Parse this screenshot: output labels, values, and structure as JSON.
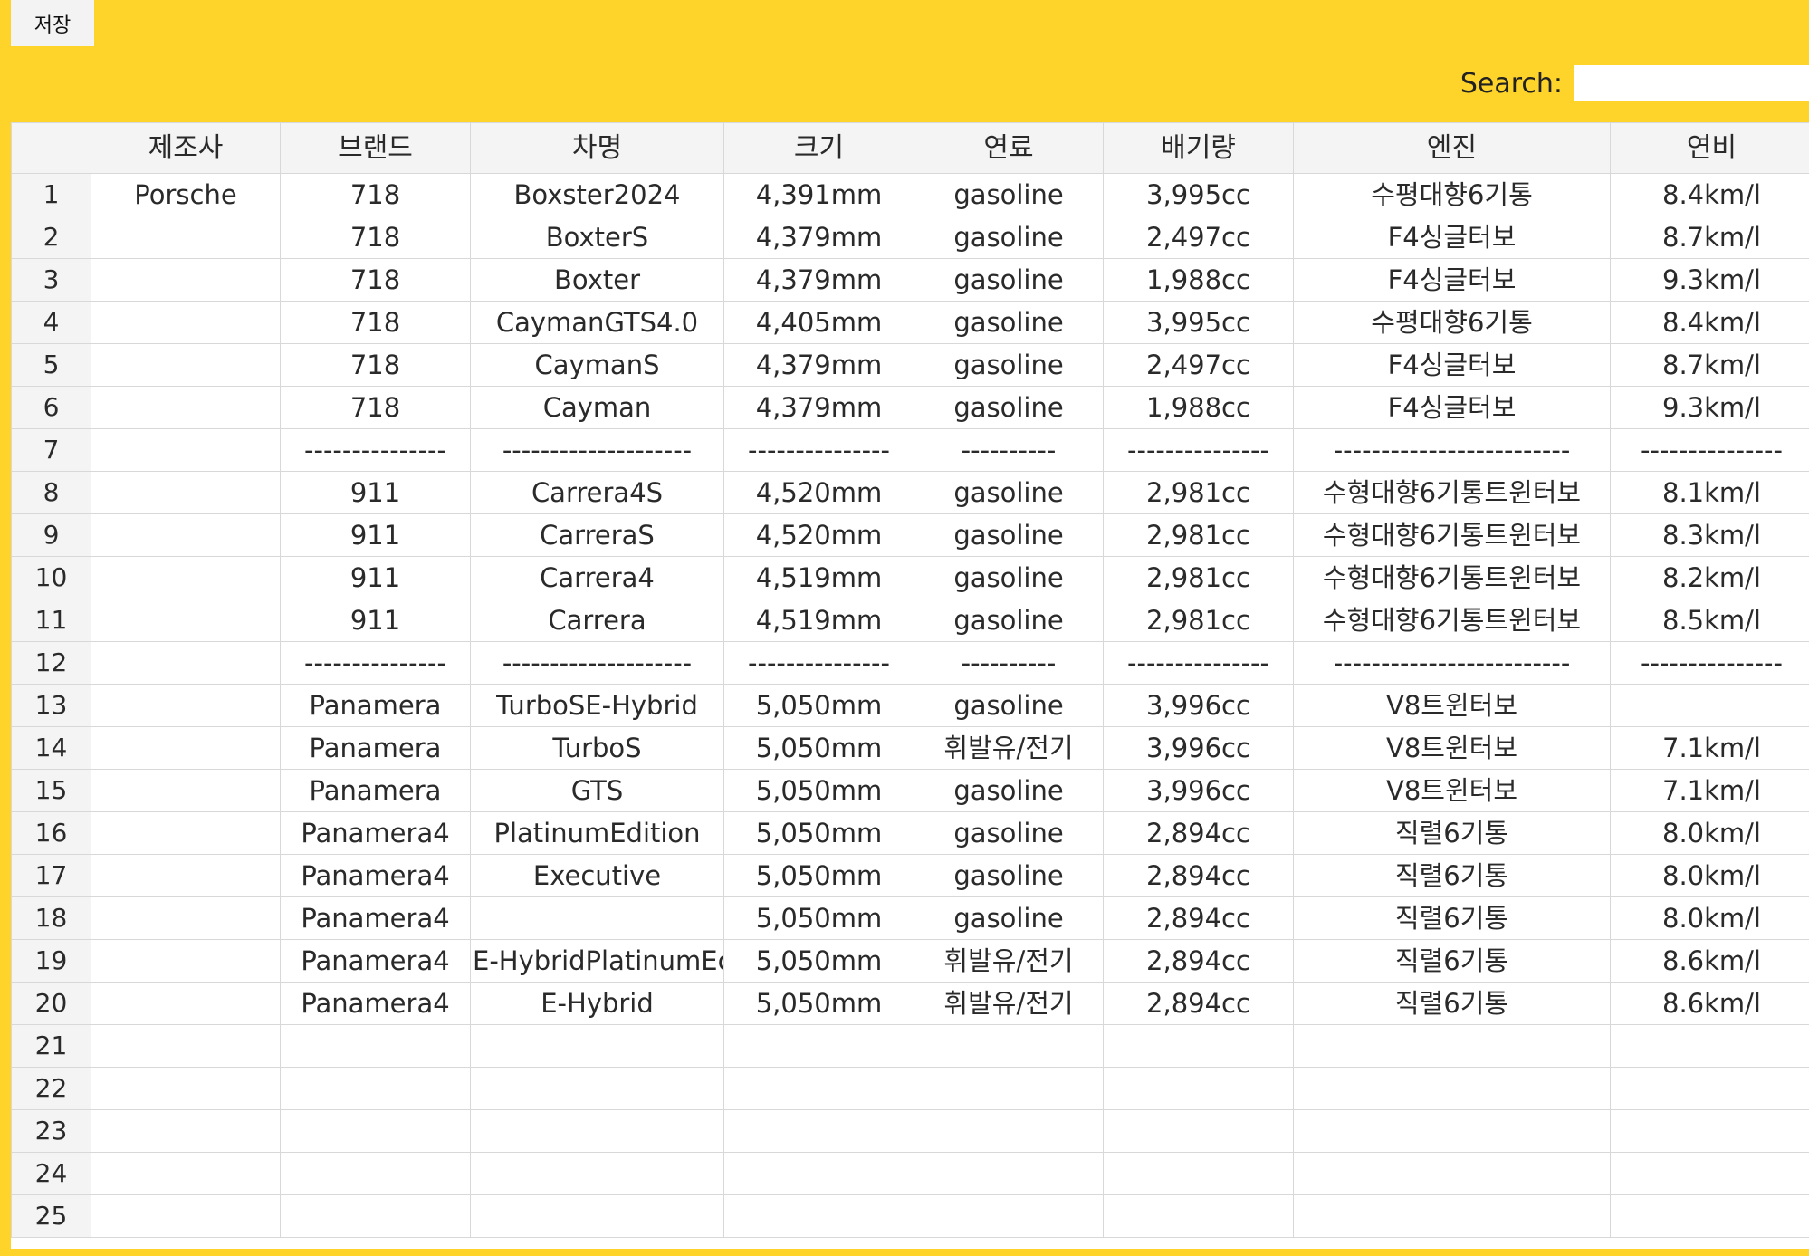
{
  "toolbar": {
    "save_label": "저장"
  },
  "search": {
    "label": "Search:",
    "value": "",
    "placeholder": ""
  },
  "table": {
    "headers": [
      "",
      "제조사",
      "브랜드",
      "차명",
      "크기",
      "연료",
      "배기량",
      "엔진",
      "연비"
    ],
    "rows": [
      [
        "1",
        "Porsche",
        "718",
        "Boxster2024",
        "4,391mm",
        "gasoline",
        "3,995cc",
        "수평대향6기통",
        "8.4km/l"
      ],
      [
        "2",
        "",
        "718",
        "BoxterS",
        "4,379mm",
        "gasoline",
        "2,497cc",
        "F4싱글터보",
        "8.7km/l"
      ],
      [
        "3",
        "",
        "718",
        "Boxter",
        "4,379mm",
        "gasoline",
        "1,988cc",
        "F4싱글터보",
        "9.3km/l"
      ],
      [
        "4",
        "",
        "718",
        "CaymanGTS4.0",
        "4,405mm",
        "gasoline",
        "3,995cc",
        "수평대향6기통",
        "8.4km/l"
      ],
      [
        "5",
        "",
        "718",
        "CaymanS",
        "4,379mm",
        "gasoline",
        "2,497cc",
        "F4싱글터보",
        "8.7km/l"
      ],
      [
        "6",
        "",
        "718",
        "Cayman",
        "4,379mm",
        "gasoline",
        "1,988cc",
        "F4싱글터보",
        "9.3km/l"
      ],
      [
        "7",
        "",
        "---------------",
        "--------------------",
        "---------------",
        "----------",
        "---------------",
        "-------------------------",
        "---------------"
      ],
      [
        "8",
        "",
        "911",
        "Carrera4S",
        "4,520mm",
        "gasoline",
        "2,981cc",
        "수형대향6기통트윈터보",
        "8.1km/l"
      ],
      [
        "9",
        "",
        "911",
        "CarreraS",
        "4,520mm",
        "gasoline",
        "2,981cc",
        "수형대향6기통트윈터보",
        "8.3km/l"
      ],
      [
        "10",
        "",
        "911",
        "Carrera4",
        "4,519mm",
        "gasoline",
        "2,981cc",
        "수형대향6기통트윈터보",
        "8.2km/l"
      ],
      [
        "11",
        "",
        "911",
        "Carrera",
        "4,519mm",
        "gasoline",
        "2,981cc",
        "수형대향6기통트윈터보",
        "8.5km/l"
      ],
      [
        "12",
        "",
        "---------------",
        "--------------------",
        "---------------",
        "----------",
        "---------------",
        "-------------------------",
        "---------------"
      ],
      [
        "13",
        "",
        "Panamera",
        "TurboSE-Hybrid",
        "5,050mm",
        "gasoline",
        "3,996cc",
        "V8트윈터보",
        ""
      ],
      [
        "14",
        "",
        "Panamera",
        "TurboS",
        "5,050mm",
        "휘발유/전기",
        "3,996cc",
        "V8트윈터보",
        "7.1km/l"
      ],
      [
        "15",
        "",
        "Panamera",
        "GTS",
        "5,050mm",
        "gasoline",
        "3,996cc",
        "V8트윈터보",
        "7.1km/l"
      ],
      [
        "16",
        "",
        "Panamera4",
        "PlatinumEdition",
        "5,050mm",
        "gasoline",
        "2,894cc",
        "직렬6기통",
        "8.0km/l"
      ],
      [
        "17",
        "",
        "Panamera4",
        "Executive",
        "5,050mm",
        "gasoline",
        "2,894cc",
        "직렬6기통",
        "8.0km/l"
      ],
      [
        "18",
        "",
        "Panamera4",
        "",
        "5,050mm",
        "gasoline",
        "2,894cc",
        "직렬6기통",
        "8.0km/l"
      ],
      [
        "19",
        "",
        "Panamera4",
        "E-HybridPlatinumEc",
        "5,050mm",
        "휘발유/전기",
        "2,894cc",
        "직렬6기통",
        "8.6km/l"
      ],
      [
        "20",
        "",
        "Panamera4",
        "E-Hybrid",
        "5,050mm",
        "휘발유/전기",
        "2,894cc",
        "직렬6기통",
        "8.6km/l"
      ],
      [
        "21",
        "",
        "",
        "",
        "",
        "",
        "",
        "",
        ""
      ],
      [
        "22",
        "",
        "",
        "",
        "",
        "",
        "",
        "",
        ""
      ],
      [
        "23",
        "",
        "",
        "",
        "",
        "",
        "",
        "",
        ""
      ],
      [
        "24",
        "",
        "",
        "",
        "",
        "",
        "",
        "",
        ""
      ],
      [
        "25",
        "",
        "",
        "",
        "",
        "",
        "",
        "",
        ""
      ]
    ]
  },
  "colors": {
    "background": "#FFD42A",
    "header_bg": "#F4F4F4",
    "grid_line": "#D8D8D8",
    "cell_bg": "#FFFFFF"
  }
}
